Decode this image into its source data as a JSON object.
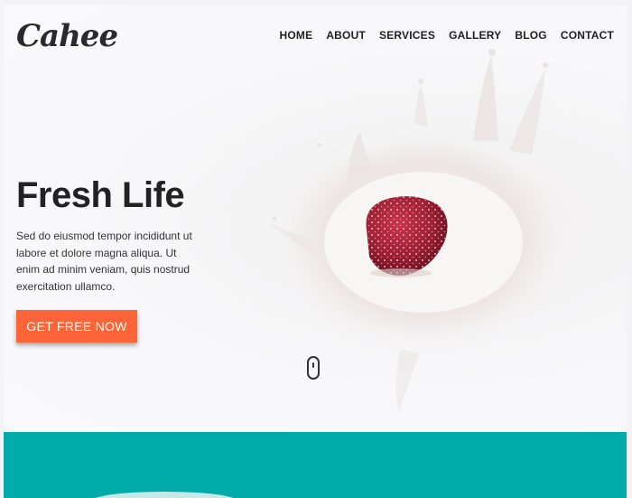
{
  "brand": {
    "logo_text": "Cahee"
  },
  "nav": {
    "items": [
      "HOME",
      "ABOUT",
      "SERVICES",
      "GALLERY",
      "BLOG",
      "CONTACT"
    ]
  },
  "hero": {
    "headline": "Fresh Life",
    "description": "Sed do eiusmod tempor incididunt ut labore et dolore magna aliqua. Ut enim ad minim veniam, quis nostrud exercitation ullamco.",
    "cta_label": "GET FREE NOW",
    "scroll_icon": "mouse-scroll-icon",
    "image": "strawberry-milk-splash"
  },
  "colors": {
    "accent": "#fd6437",
    "teal_band": "#00aba9",
    "heading": "#222222"
  }
}
